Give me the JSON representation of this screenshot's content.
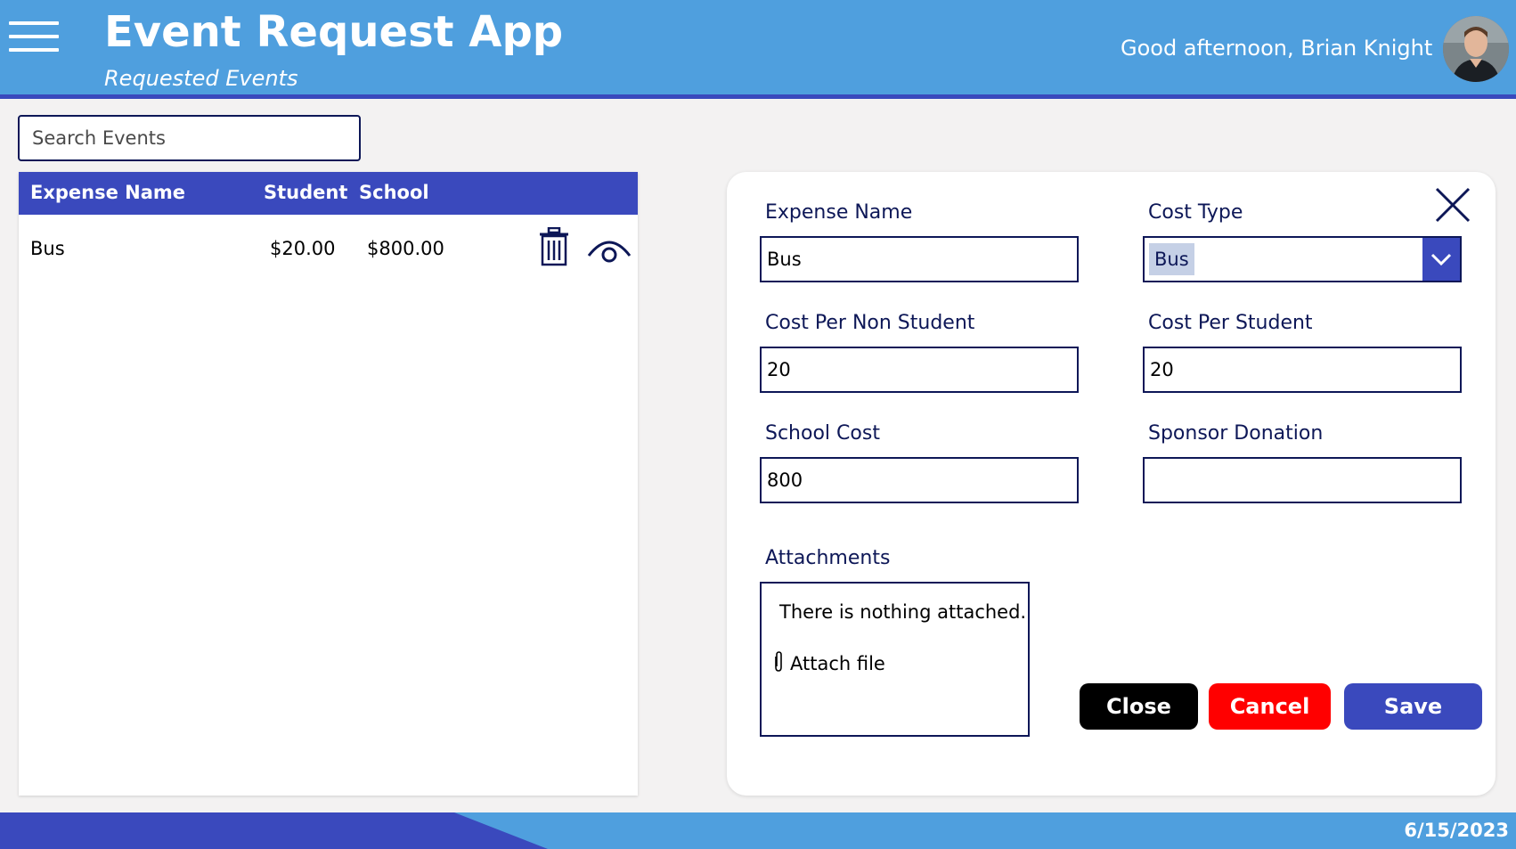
{
  "header": {
    "title": "Event Request App",
    "subtitle": "Requested Events",
    "greeting": "Good afternoon,  Brian Knight"
  },
  "search": {
    "placeholder": "Search Events"
  },
  "list": {
    "columns": [
      "Expense Name",
      "Student",
      "School"
    ],
    "rows": [
      {
        "expense_name": "Bus",
        "student": "$20.00",
        "school": "$800.00"
      }
    ]
  },
  "form": {
    "expense_name": {
      "label": "Expense Name",
      "value": "Bus"
    },
    "cost_type": {
      "label": "Cost Type",
      "value": "Bus"
    },
    "cost_non_student": {
      "label": "Cost Per Non Student",
      "value": "20"
    },
    "cost_student": {
      "label": "Cost Per Student",
      "value": "20"
    },
    "school_cost": {
      "label": "School Cost",
      "value": "800"
    },
    "sponsor_donation": {
      "label": "Sponsor Donation",
      "value": ""
    },
    "attachments": {
      "label": "Attachments",
      "empty_text": "There is nothing attached.",
      "attach_label": "Attach file"
    },
    "buttons": {
      "close": "Close",
      "cancel": "Cancel",
      "save": "Save"
    }
  },
  "footer": {
    "date": "6/15/2023"
  },
  "colors": {
    "header": "#4f9fde",
    "accent": "#3a49bd",
    "navy": "#0d1757",
    "cancel": "#ff0000",
    "close": "#000000"
  }
}
